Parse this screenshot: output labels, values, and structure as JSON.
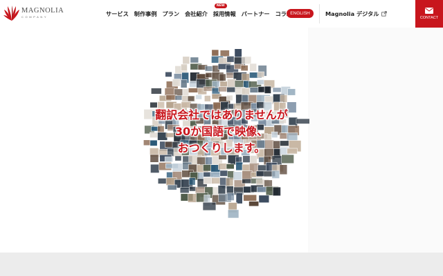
{
  "brand": {
    "name": "MAGNOLIA",
    "sub": "COMPANY",
    "color": "#c8161d"
  },
  "nav": {
    "items": [
      {
        "label": "サービス"
      },
      {
        "label": "制作事例"
      },
      {
        "label": "プラン"
      },
      {
        "label": "会社紹介"
      },
      {
        "label": "採用情報",
        "badge": "NEW"
      },
      {
        "label": "パートナー"
      },
      {
        "label": "コラム"
      }
    ],
    "language_button": "ENGLISH",
    "digital_link": "Magnolia デジタル",
    "contact_label": "CONTACT",
    "icons": [
      "external-link-icon",
      "mail-icon"
    ]
  },
  "hero": {
    "headline_lines": [
      "翻訳会社ではありませんが",
      "30か国語で映像、",
      "おつくりします。"
    ]
  }
}
